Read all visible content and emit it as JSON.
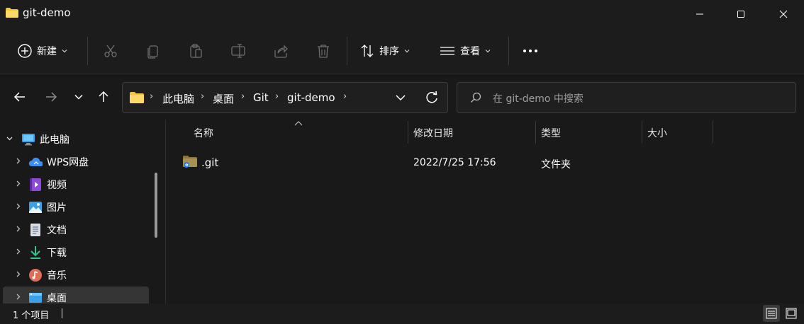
{
  "window": {
    "title": "git-demo"
  },
  "toolbar": {
    "new_label": "新建",
    "sort_label": "排序",
    "view_label": "查看"
  },
  "breadcrumb": [
    "此电脑",
    "桌面",
    "Git",
    "git-demo"
  ],
  "search": {
    "placeholder": "在 git-demo 中搜索"
  },
  "nav": {
    "root": "此电脑",
    "items": [
      {
        "label": "WPS网盘",
        "icon": "cloud-icon"
      },
      {
        "label": "视频",
        "icon": "video-icon"
      },
      {
        "label": "图片",
        "icon": "pictures-icon"
      },
      {
        "label": "文档",
        "icon": "documents-icon"
      },
      {
        "label": "下载",
        "icon": "download-icon"
      },
      {
        "label": "音乐",
        "icon": "music-icon"
      },
      {
        "label": "桌面",
        "icon": "desktop-icon"
      }
    ]
  },
  "columns": {
    "name": "名称",
    "modified": "修改日期",
    "type": "类型",
    "size": "大小"
  },
  "files": [
    {
      "name": ".git",
      "modified": "2022/7/25 17:56",
      "type": "文件夹",
      "size": ""
    }
  ],
  "status": {
    "count": "1 个项目"
  },
  "colors": {
    "folder": "#f4c542",
    "accent": "#60cdff",
    "background": "#191919"
  }
}
